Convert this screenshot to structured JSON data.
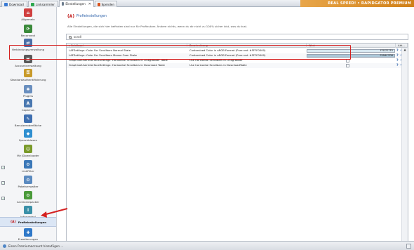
{
  "tabs": [
    {
      "label": "Download",
      "icon": "download-icon",
      "color": "#3a7bd5",
      "active": false
    },
    {
      "label": "Linksammler",
      "icon": "linkgrabber-icon",
      "color": "#2fa84f",
      "active": false
    },
    {
      "label": "Einstellungen",
      "icon": "settings-icon",
      "color": "#6b7b8c",
      "active": true,
      "close": "✕"
    },
    {
      "label": "Spenden",
      "icon": "donate-icon",
      "color": "#d9541e",
      "active": false
    }
  ],
  "brand": "REAL SPEED! • RAPIDGATOR PREMIUM",
  "sidebar": {
    "items": [
      {
        "label": "Allgemein",
        "icon": "home-icon",
        "color": "#d04040",
        "glyph": "⌂",
        "check": false
      },
      {
        "label": "Reconnect",
        "icon": "reconnect-icon",
        "color": "#3b8a3b",
        "glyph": "⟳",
        "check": false
      },
      {
        "label": "Verbindungsverwaltung",
        "icon": "network-icon",
        "color": "#4b70a8",
        "glyph": "⇄",
        "check": false
      },
      {
        "label": "Accountverwaltung",
        "icon": "account-icon",
        "color": "#5a5a5a",
        "glyph": "▣",
        "check": false
      },
      {
        "label": "Standardauthentifizierung",
        "icon": "key-icon",
        "color": "#c89a2a",
        "glyph": "⚿",
        "check": false
      },
      {
        "label": "Plugins",
        "icon": "plugin-icon",
        "color": "#6a8fbf",
        "glyph": "✱",
        "check": false
      },
      {
        "label": "Captchas",
        "icon": "captcha-icon",
        "color": "#4a78b0",
        "glyph": "A",
        "check": false
      },
      {
        "label": "Benutzeroberfläche",
        "icon": "ui-icon",
        "color": "#3f6fb0",
        "glyph": "✎",
        "check": false
      },
      {
        "label": "Sprechblasen",
        "icon": "bubble-icon",
        "color": "#2f8fd0",
        "glyph": "◆",
        "check": false
      },
      {
        "label": "My JDownloader",
        "icon": "myjd-icon",
        "color": "#7a9a2a",
        "glyph": "☺",
        "check": false
      },
      {
        "label": "LinkFilter",
        "icon": "linkfilter-icon",
        "color": "#3b78b8",
        "glyph": "⚙",
        "check": true
      },
      {
        "label": "Paketverwalter",
        "icon": "package-icon",
        "color": "#5a8ac0",
        "glyph": "⚙",
        "check": true
      },
      {
        "label": "Archiventpacker",
        "icon": "archive-icon",
        "color": "#4a9a3a",
        "glyph": "⚙",
        "check": true
      },
      {
        "label": "Infosymbol",
        "icon": "info-icon",
        "color": "#3a90a8",
        "glyph": "i",
        "check": false
      },
      {
        "label": "Profieinstellungen",
        "icon": "advanced-icon",
        "color": "#ffffff",
        "glyph": "(A)",
        "check": false,
        "selected": true
      },
      {
        "label": "Erweiterungen",
        "icon": "extensions-icon",
        "color": "#2f78c8",
        "glyph": "✚",
        "check": false
      }
    ]
  },
  "main": {
    "title": "Profieinstellungen",
    "description": "Alle Einstellungen, die sich hier befinden sind nur für Profinutzer. Ändere nichts, wenn du dir nicht zu 100% sicher bist, was du tust.",
    "search_value": "scroll",
    "columns": [
      "Schlüssel",
      "Beschreibung",
      "Wert",
      "Akt..."
    ],
    "rows": [
      {
        "key": "LAFSettings: Color For Scrollbars Normal State",
        "desc": "Customized Color in aRGB Format (Pure red: #FFFF0000)",
        "value": "FFD7E7F0",
        "swatch": "#d7e7f0",
        "type": "color"
      },
      {
        "key": "LAFSettings: Color For Scrollbars Mouse Over State",
        "desc": "Customized Color in aRGB Format (Pure red: #FFFF0000)",
        "value": "FFABC7D8",
        "swatch": "#abc7d8",
        "type": "color"
      },
      {
        "key": "GraphicalUserInterfaceSettings: Horizontal Scrollbars in Linkgrabber Table",
        "desc": "Use horizontal Scrollbars in Linkgrabber",
        "value": "",
        "type": "bool"
      },
      {
        "key": "GraphicalUserInterfaceSettings: Horizontal Scrollbars in Download Table",
        "desc": "Use horizontal Scrollbars in DownloadTable",
        "value": "",
        "type": "bool"
      }
    ]
  },
  "status": {
    "text": "Einen Premiumaccount hinzufügen ..."
  },
  "colors": {
    "highlight": "#d42020",
    "link": "#2a5fa8"
  }
}
